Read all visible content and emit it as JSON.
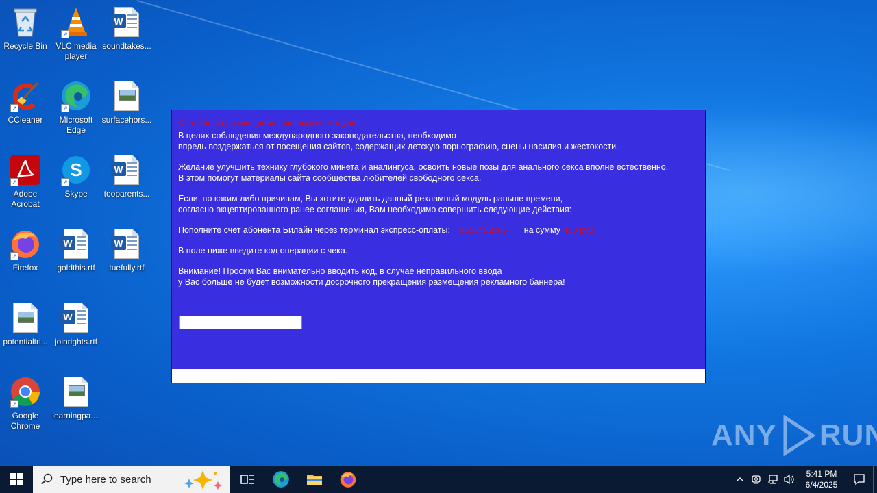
{
  "desktop": {
    "icons": [
      {
        "label": "Recycle Bin"
      },
      {
        "label": "VLC media player"
      },
      {
        "label": "soundtakes..."
      },
      {
        "label": "CCleaner"
      },
      {
        "label": "Microsoft Edge"
      },
      {
        "label": "surfacehors..."
      },
      {
        "label": "Adobe Acrobat"
      },
      {
        "label": "Skype"
      },
      {
        "label": "tooparents..."
      },
      {
        "label": "Firefox"
      },
      {
        "label": "goldthis.rtf"
      },
      {
        "label": "tuefully.rtf"
      },
      {
        "label": "potentialtri..."
      },
      {
        "label": "joinrights.rtf"
      },
      {
        "label": "Google Chrome"
      },
      {
        "label": "learningpa...."
      }
    ]
  },
  "window": {
    "title": "Спасибо за размещение рекламного модуля!",
    "para1_line1": "В целях соблюдения международного законодательства, необходимо",
    "para1_line2": "впредь воздержаться от посещения сайтов, содержащих детскую порнографию, сцены насилия и жестокости.",
    "para2_line1": "Желание улучшить технику глубокого минета и аналингуса, освоить новые позы для анального секса вполне естественно.",
    "para2_line2": "В этом помогут материалы сайта сообщества любителей свободного секса.",
    "para3_line1": "Если, по каким либо причинам, Вы хотите удалить данный рекламный модуль раньше времени,",
    "para3_line2": "согласно акцептированного ранее соглашения, Вам необходимо совершить следующие действия:",
    "pay_prefix": "Пополните счет абонента Билайн через терминал экспресс-оплаты:",
    "phone": "9653452006",
    "amount_prefix": "на сумму",
    "amount": "450 руб.",
    "instruction": "В поле ниже введите код операции с чека.",
    "warning_line1": "Внимание! Просим Вас внимательно вводить код, в случае неправильного ввода",
    "warning_line2": "у Вас больше не будет возможности досрочного прекращения размещения рекламного баннера!",
    "code_value": ""
  },
  "watermark": {
    "left": "ANY",
    "right": "RUN"
  },
  "taskbar": {
    "search_placeholder": "Type here to search",
    "clock_time": "5:41 PM",
    "clock_date": "6/4/2025"
  },
  "colors": {
    "window_bg": "#3a2fe0",
    "highlight_red": "#c8102e",
    "taskbar": "#0b1a33"
  }
}
